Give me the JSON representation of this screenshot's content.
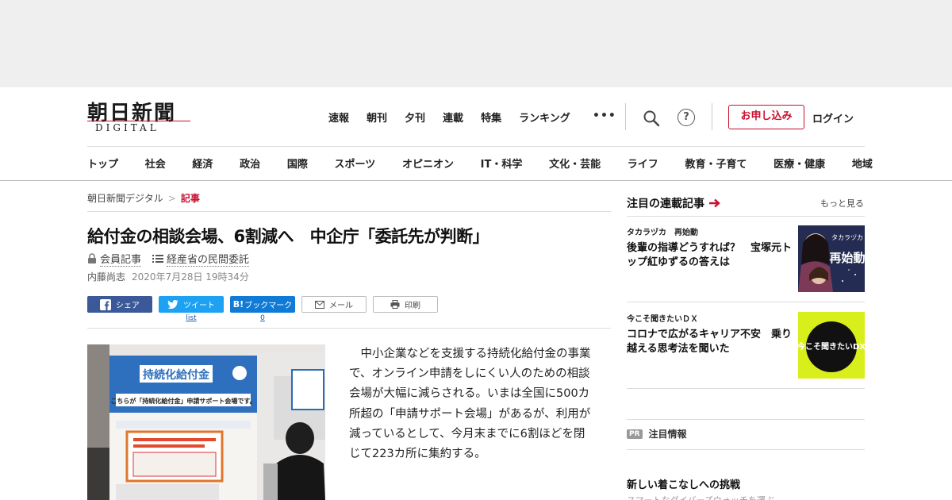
{
  "header": {
    "logo_main": "朝日新聞",
    "logo_sub": "DIGITAL",
    "nav": [
      "速報",
      "朝刊",
      "夕刊",
      "連載",
      "特集",
      "ランキング"
    ],
    "more": "•••",
    "signup_label": "お申し込み",
    "login_label": "ログイン"
  },
  "categories": [
    "トップ",
    "社会",
    "経済",
    "政治",
    "国際",
    "スポーツ",
    "オピニオン",
    "IT・科学",
    "文化・芸能",
    "ライフ",
    "教育・子育て",
    "医療・健康",
    "地域"
  ],
  "breadcrumb": {
    "home": "朝日新聞デジタル",
    "separator": ">",
    "current": "記事"
  },
  "article": {
    "headline": "給付金の相談会場、6割減へ　中企庁「委託先が判断」",
    "tag_member": "会員記事",
    "tag_series": "経産省の民間委託",
    "author": "内藤尚志",
    "date": "2020年7月28日 19時34分",
    "body": "中小企業などを支援する持続化給付金の事業で、オンライン申請をしにくい人のための相談会場が大幅に減らされる。いまは全国に500カ所超の「申請サポート会場」があるが、利用が減っているとして、今月末までに6割ほどを閉じて223カ所に集約する。",
    "photo_sign_title": "持続化給付金",
    "photo_sign_sub": "こちらが「持続化給付金」申請サポート会場です。"
  },
  "share": {
    "facebook": "シェア",
    "twitter": "ツイート",
    "twitter_count": "list",
    "hatena": "ブックマーク",
    "hatena_icon": "B!",
    "hatena_count": "0",
    "mail": "メール",
    "print": "印刷"
  },
  "sidebar": {
    "title": "注目の連載記事",
    "more": "もっと見る",
    "items": [
      {
        "kicker": "タカラヅカ　再始動",
        "title": "後輩の指導どうすれば？　宝塚元トップ紅ゆずるの答えは",
        "thumb_text": "再始動",
        "thumb_top": "タカラヅカ"
      },
      {
        "kicker": "今こそ聞きたいＤＸ",
        "title": "コロナで広がるキャリア不安　乗り越える思考法を聞いた",
        "thumb_text": "今こそ聞きたいDX"
      }
    ],
    "pr_badge": "PR",
    "pr_label": "注目情報",
    "fashion_title": "新しい着こなしへの挑戦",
    "fashion_sub": "スマートなダイバーズウォッチを選ぶ"
  },
  "colors": {
    "accent": "#c8102e",
    "facebook": "#3b5998",
    "twitter": "#1da1f2",
    "hatena": "#0f7bd6"
  }
}
